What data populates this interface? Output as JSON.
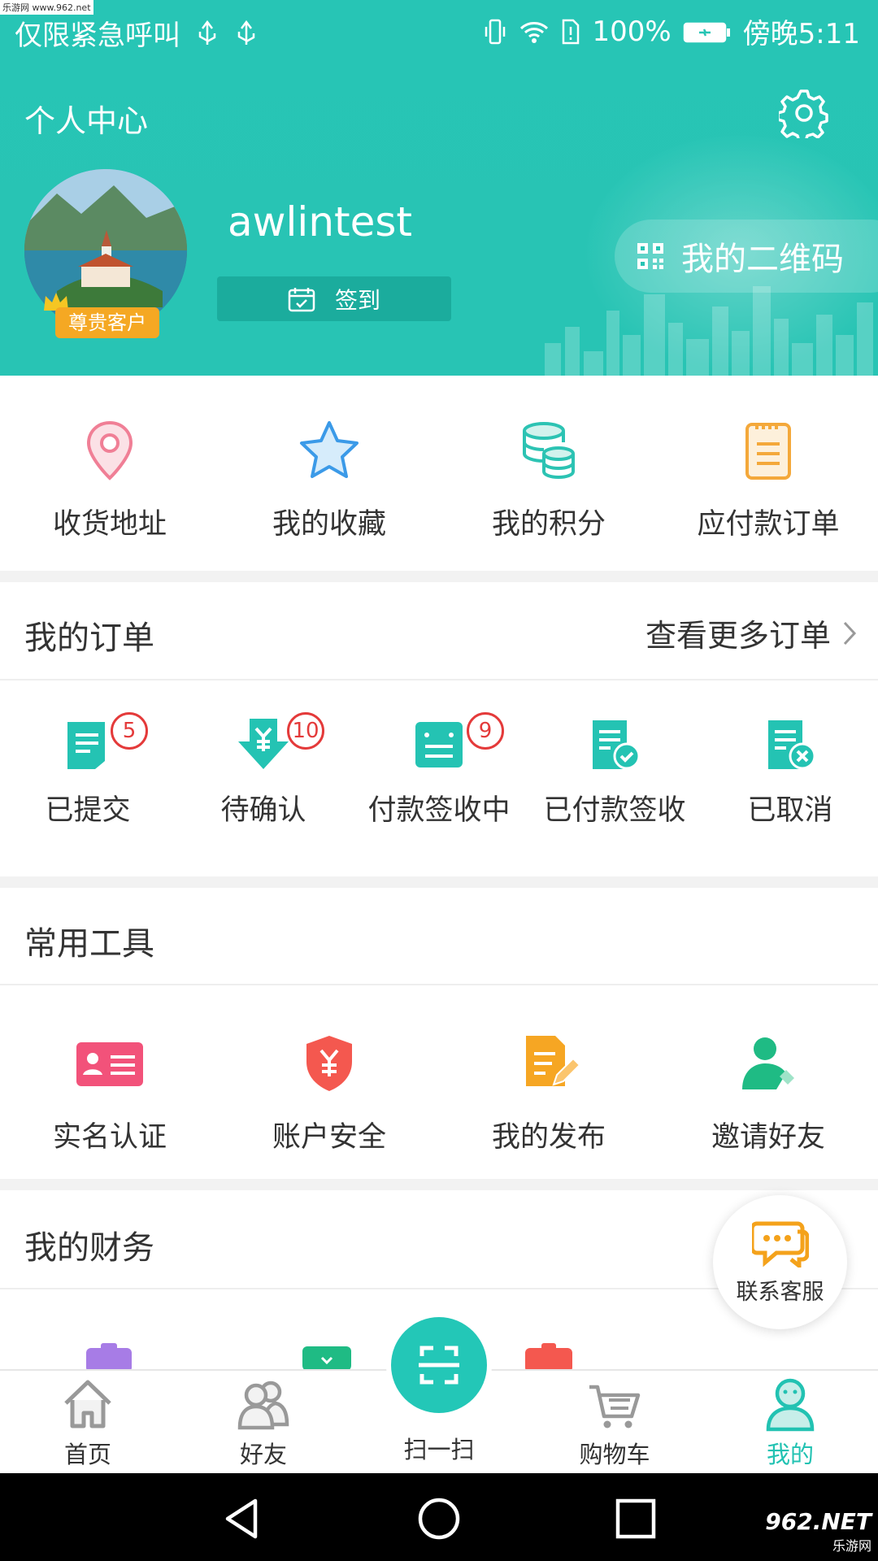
{
  "watermark_top": "乐游网 www.962.net",
  "status_bar": {
    "carrier": "仅限紧急呼叫",
    "battery": "100%",
    "time": "傍晚5:11"
  },
  "header": {
    "title": "个人中心",
    "username": "awlintest",
    "vip_label": "尊贵客户",
    "signin_label": "签到",
    "qr_label": "我的二维码"
  },
  "quick_links": [
    {
      "label": "收货地址",
      "icon": "location-pin-icon"
    },
    {
      "label": "我的收藏",
      "icon": "star-icon"
    },
    {
      "label": "我的积分",
      "icon": "coins-icon"
    },
    {
      "label": "应付款订单",
      "icon": "clipboard-icon"
    }
  ],
  "orders": {
    "title": "我的订单",
    "more_label": "查看更多订单",
    "items": [
      {
        "label": "已提交",
        "badge": "5",
        "icon": "doc-submitted-icon"
      },
      {
        "label": "待确认",
        "badge": "10",
        "icon": "yuan-down-icon"
      },
      {
        "label": "付款签收中",
        "badge": "9",
        "icon": "doc-lines-icon"
      },
      {
        "label": "已付款签收",
        "badge": "",
        "icon": "doc-check-icon"
      },
      {
        "label": "已取消",
        "badge": "",
        "icon": "doc-cancel-icon"
      }
    ]
  },
  "tools": {
    "title": "常用工具",
    "items": [
      {
        "label": "实名认证",
        "icon": "id-card-icon"
      },
      {
        "label": "账户安全",
        "icon": "shield-yuan-icon"
      },
      {
        "label": "我的发布",
        "icon": "doc-edit-icon"
      },
      {
        "label": "邀请好友",
        "icon": "add-user-icon"
      }
    ]
  },
  "finance": {
    "title": "我的财务"
  },
  "service_label": "联系客服",
  "tabs": [
    {
      "label": "首页",
      "icon": "home-icon"
    },
    {
      "label": "好友",
      "icon": "friends-icon"
    },
    {
      "label": "扫一扫",
      "icon": "scan-icon"
    },
    {
      "label": "购物车",
      "icon": "cart-icon"
    },
    {
      "label": "我的",
      "icon": "profile-icon"
    }
  ],
  "watermark_bottom": {
    "brand": "962.NET",
    "sub": "乐游网"
  },
  "colors": {
    "primary": "#27c5b5",
    "badge": "#e43a3a",
    "vip": "#f5a823"
  }
}
